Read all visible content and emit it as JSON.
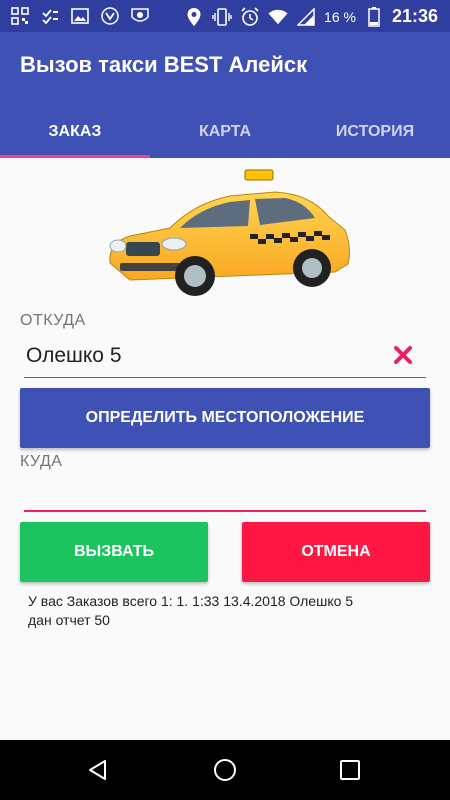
{
  "status_bar": {
    "battery_percent": "16 %",
    "time": "21:36"
  },
  "app": {
    "title": "Вызов такси BEST Алейск"
  },
  "tabs": [
    {
      "label": "ЗАКАЗ",
      "active": true
    },
    {
      "label": "КАРТА",
      "active": false
    },
    {
      "label": "ИСТОРИЯ",
      "active": false
    }
  ],
  "form": {
    "from_label": "ОТКУДА",
    "from_value": "Олешко 5",
    "locate_button": "ОПРЕДЕЛИТЬ МЕСТОПОЛОЖЕНИЕ",
    "to_label": "КУДА",
    "to_value": "",
    "call_button": "ВЫЗВАТЬ",
    "cancel_button": "ОТМЕНА"
  },
  "info": {
    "line1": "У вас Заказов всего 1:  1. 1:33 13.4.2018 Олешко 5",
    "line2": "дан отчет 50"
  },
  "colors": {
    "status_bar": "#303F9F",
    "app_bar": "#3F51B5",
    "tab_indicator": "#FF4081",
    "call_button": "#1DC35F",
    "cancel_button": "#FF1744",
    "clear_icon": "#E91E63"
  },
  "icons": [
    "qr-icon",
    "checkmarks-icon",
    "image-icon",
    "shield-icon",
    "lion-badge-icon",
    "location-icon",
    "vibrate-icon",
    "alarm-icon",
    "wifi-icon",
    "signal-icon",
    "battery-icon",
    "clear-icon",
    "back-icon",
    "home-icon",
    "recents-icon"
  ]
}
